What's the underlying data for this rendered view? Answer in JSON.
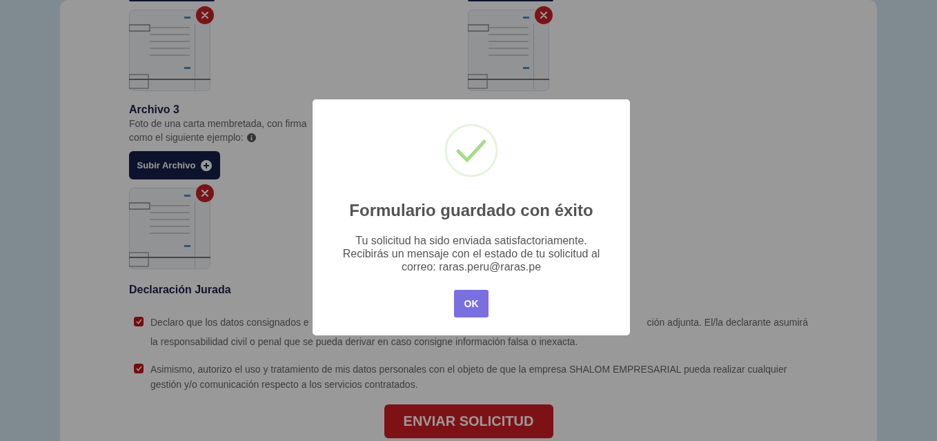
{
  "form": {
    "top_files": [
      {
        "kind": "thumbnail"
      },
      {
        "kind": "thumbnail"
      }
    ],
    "file_section": {
      "title": "Archivo 3",
      "description_lines": [
        "Foto de una carta membretada, con firma",
        "como el siguiente ejemplo:"
      ],
      "upload_button": "Subir Archivo"
    },
    "declaration": {
      "title": "Declaración Jurada",
      "items": [
        {
          "checked": true,
          "fragments": [
            "Declaro que los datos consignados e",
            "ción adjunta. El/la declarante asumirá"
          ],
          "second_line": "la responsabilidad civil o penal que se pueda derivar en caso consigne información falsa o inexacta."
        },
        {
          "checked": true,
          "fragments": [
            "Asimismo, autorizo el uso y tratamiento de mis datos personales con el objeto de que la empresa SHALOM EMPRESARIAL pueda realizar cualquier"
          ],
          "second_line": "gestión y/o comunicación respecto a los servicios contratados."
        }
      ]
    },
    "submit_button": "ENVIAR SOLICITUD"
  },
  "dialog": {
    "title": "Formulario guardado con éxito",
    "message_lines": [
      "Tu solicitud ha sido enviada satisfactoriamente.",
      "Recibirás un mensaje con el estado de tu solicitud al",
      "correo: raras.peru@raras.pe"
    ],
    "ok_button": "OK"
  }
}
